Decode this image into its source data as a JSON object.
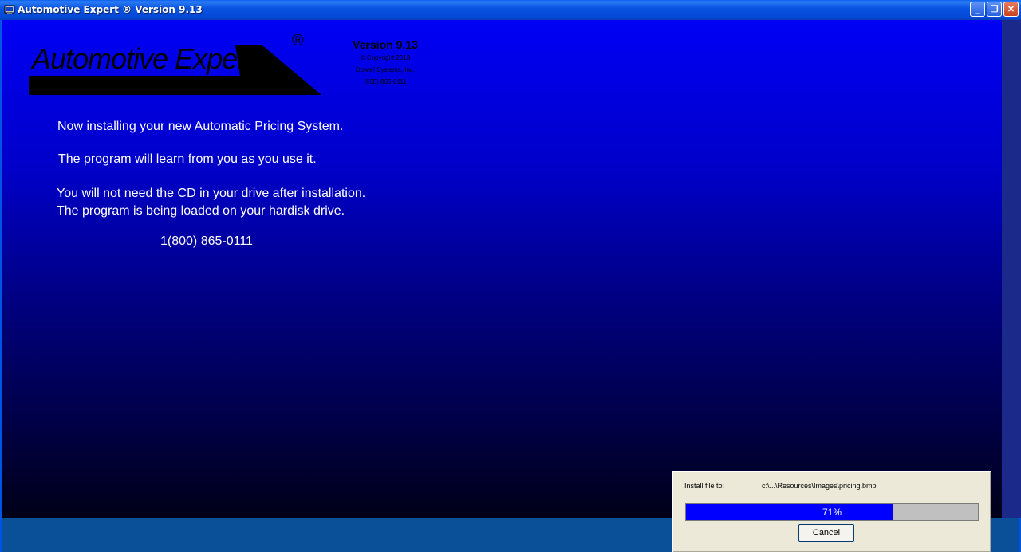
{
  "window": {
    "title": "Automotive Expert ® Version 9.13",
    "minimize_glyph": "_",
    "maximize_glyph": "❐",
    "close_glyph": "✕"
  },
  "logo": {
    "text": "Automotive Expert",
    "registered": "®"
  },
  "version_info": {
    "title": "Version 9.13",
    "copyright": "© Copyright 2013",
    "company": "Dowell Systems, Inc.",
    "phone": "(800) 865-0111"
  },
  "messages": {
    "line1": "Now installing your new Automatic Pricing System.",
    "line2": "The program will learn from you as you use it.",
    "line3": "You will not need the CD in your drive after installation.",
    "line4": "The program is being loaded on your hardisk drive.",
    "phone": "1(800) 865-0111"
  },
  "install_dialog": {
    "label": "Install file to:",
    "path": "c:\\...\\Resources\\Images\\pricing.bmp",
    "progress_percent": 71,
    "progress_text": "71%",
    "cancel_label": "Cancel"
  },
  "colors": {
    "progress_fill": "#0000ff",
    "message_text": "#ffffff"
  }
}
